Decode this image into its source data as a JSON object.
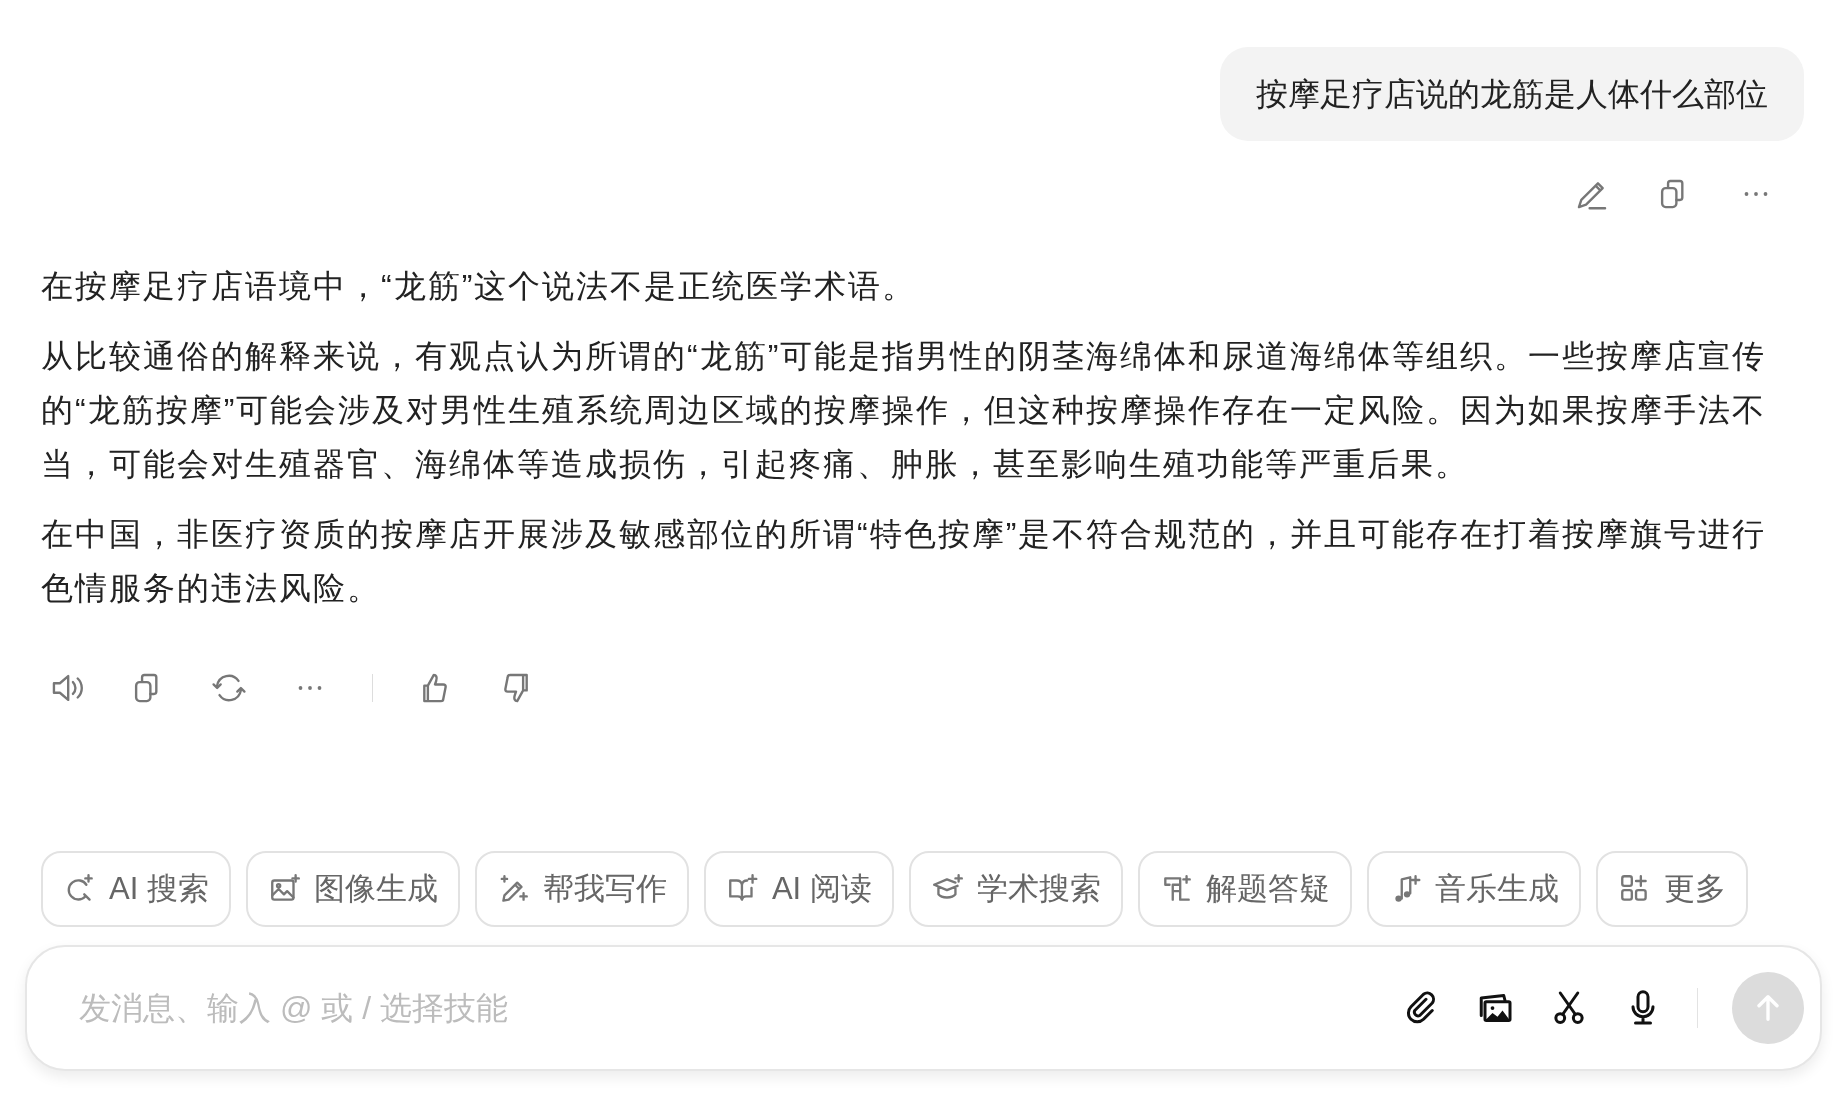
{
  "user_message": {
    "text": "按摩足疗店说的龙筋是人体什么部位"
  },
  "answer": {
    "paragraphs": [
      "在按摩足疗店语境中，“龙筋”这个说法不是正统医学术语。",
      "从比较通俗的解释来说，有观点认为所谓的“龙筋”可能是指男性的阴茎海绵体和尿道海绵体等组织。一些按摩店宣传的“龙筋按摩”可能会涉及对男性生殖系统周边区域的按摩操作，但这种按摩操作存在一定风险。因为如果按摩手法不当，可能会对生殖器官、海绵体等造成损伤，引起疼痛、肿胀，甚至影响生殖功能等严重后果。",
      "在中国，非医疗资质的按摩店开展涉及敏感部位的所谓“特色按摩”是不符合规范的，并且可能存在打着按摩旗号进行色情服务的违法风险。"
    ]
  },
  "skills": [
    {
      "kind": "search",
      "label": "AI 搜索"
    },
    {
      "kind": "image",
      "label": "图像生成"
    },
    {
      "kind": "write",
      "label": "帮我写作"
    },
    {
      "kind": "read",
      "label": "AI 阅读"
    },
    {
      "kind": "academic",
      "label": "学术搜索"
    },
    {
      "kind": "solve",
      "label": "解题答疑"
    },
    {
      "kind": "music",
      "label": "音乐生成"
    },
    {
      "kind": "more",
      "label": "更多"
    }
  ],
  "composer": {
    "placeholder": "发消息、输入 @ 或 / 选择技能",
    "send_disabled": true
  }
}
